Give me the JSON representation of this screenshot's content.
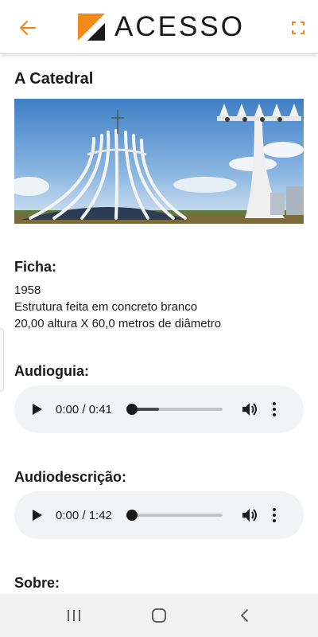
{
  "header": {
    "logo_text": "ACESSO",
    "back_icon": "arrow-left-icon",
    "fullscreen_icon": "fullscreen-icon",
    "accent_color": "#f08a1c"
  },
  "page": {
    "title": "A Catedral"
  },
  "ficha": {
    "heading": "Ficha:",
    "lines": [
      "1958",
      "Estrutura feita em concreto branco",
      "20,00 altura X 60,0 metros de diâmetro"
    ]
  },
  "audioguia": {
    "heading": "Audioguia:",
    "time": "0:00 / 0:41",
    "buffered": 0.3,
    "progress": 0
  },
  "audiodescricao": {
    "heading": "Audiodescrição:",
    "time": "0:00 / 1:42",
    "buffered": 0,
    "progress": 0
  },
  "sobre": {
    "heading": "Sobre:"
  },
  "nav": {
    "recents_icon": "recents-icon",
    "home_icon": "home-icon",
    "back_icon": "back-chevron-icon"
  }
}
